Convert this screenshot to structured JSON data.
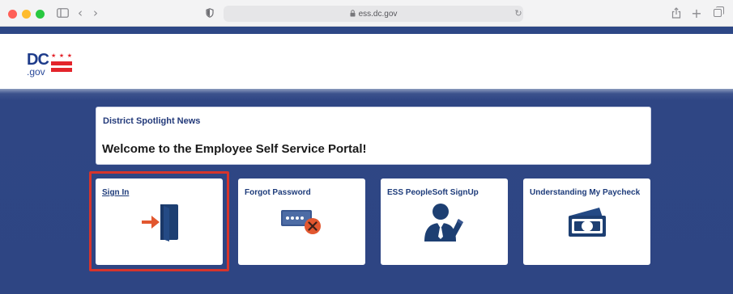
{
  "browser": {
    "url": "ess.dc.gov",
    "icons": [
      "sidebar-icon",
      "back-icon",
      "forward-icon",
      "shield-icon",
      "lock-icon",
      "reload-icon",
      "share-icon",
      "plus-icon",
      "tabs-icon"
    ]
  },
  "header": {
    "logo": {
      "top": "DC",
      "bottom": ".gov"
    },
    "stripe_color": "#2d4786"
  },
  "news": {
    "label": "District Spotlight News",
    "title": "Welcome to the Employee Self Service Portal!"
  },
  "tiles": [
    {
      "label": "Sign In",
      "icon": "sign-in-door-icon"
    },
    {
      "label": "Forgot Password",
      "icon": "password-field-error-icon"
    },
    {
      "label": "ESS PeopleSoft SignUp",
      "icon": "person-pen-icon"
    },
    {
      "label": "Understanding My Paycheck",
      "icon": "money-bill-icon"
    }
  ],
  "colors": {
    "page_background": "#2e4583",
    "accent_red": "#e3242b",
    "highlight_border": "#d7342b",
    "tile_label": "#1d3b7a"
  }
}
